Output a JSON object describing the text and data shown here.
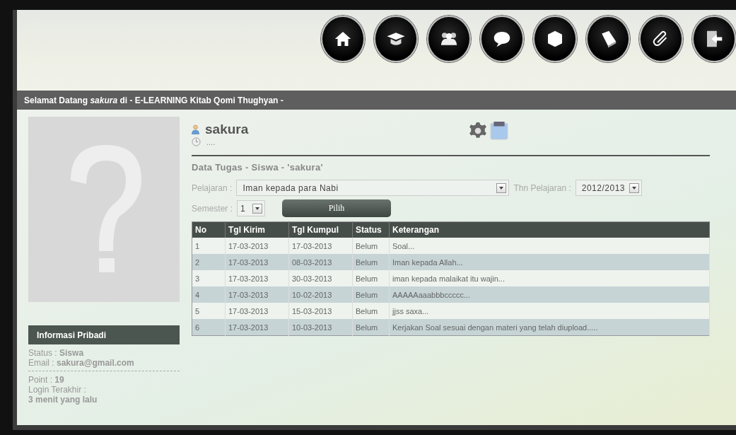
{
  "welcome_bar": {
    "text": "Selamat Datang *sakura* di - E-LEARNING Kitab Qomi Thughyan -"
  },
  "sidebar": {
    "info_title": "Informasi Pribadi",
    "lines": [
      "Status : **Siswa**",
      "Email : **sakura@gmail.com**"
    ],
    "lines_after_divider": [
      "Point : **19**",
      "Login Terakhir :",
      "**3 menit yang lalu**"
    ]
  },
  "profile": {
    "username": "sakura",
    "last_seen": "...."
  },
  "section_title": "Data Tugas - Siswa - 'sakura'",
  "filters": {
    "subject_label": "Pelajaran :",
    "subject_value": "Iman kepada para Nabi",
    "year_label": "Thn Pelajaran :",
    "year_value": "2012/2013",
    "semester_label": "Semester :",
    "semester_value": "1",
    "submit": "Pilih"
  },
  "table": {
    "columns": [
      "No",
      "Tgl Kirim",
      "Tgl Kumpul",
      "Status",
      "Keterangan"
    ],
    "rows": [
      [
        "1",
        "17-03-2013",
        "17-03-2013",
        "Belum",
        "Soal..."
      ],
      [
        "2",
        "17-03-2013",
        "08-03-2013",
        "Belum",
        "Iman kepada Allah..."
      ],
      [
        "3",
        "17-03-2013",
        "30-03-2013",
        "Belum",
        "iman kepada malaikat itu wajin..."
      ],
      [
        "4",
        "17-03-2013",
        "10-02-2013",
        "Belum",
        "AAAAAaaabbbccccc..."
      ],
      [
        "5",
        "17-03-2013",
        "15-03-2013",
        "Belum",
        "jjss saxa..."
      ],
      [
        "6",
        "17-03-2013",
        "10-03-2013",
        "Belum",
        "Kerjakan Soal sesuai dengan materi yang telah diupload....."
      ]
    ]
  }
}
